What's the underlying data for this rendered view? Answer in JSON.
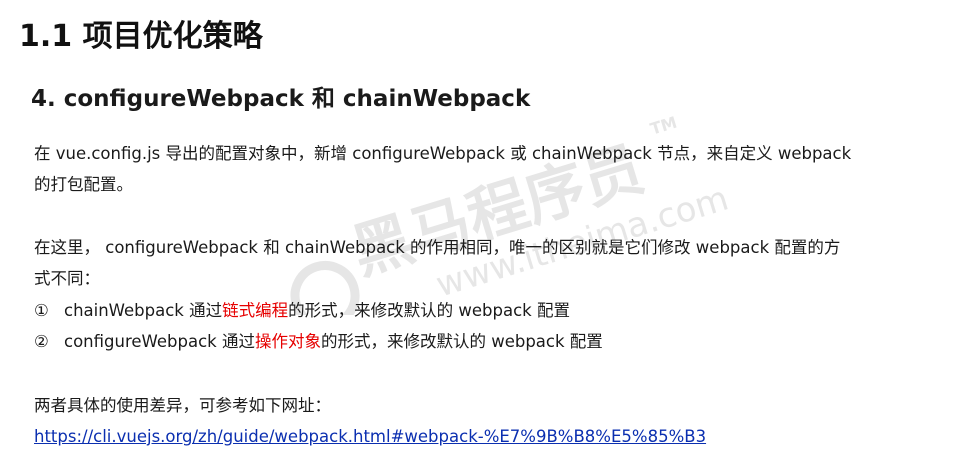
{
  "heading": "1.1 项目优化策略",
  "subheading": "4. configureWebpack 和 chainWebpack",
  "paragraph1": {
    "line1": "在 vue.config.js 导出的配置对象中，新增 configureWebpack 或 chainWebpack 节点，来自定义 webpack",
    "line2": "的打包配置。"
  },
  "paragraph2": {
    "line1": "在这里， configureWebpack 和 chainWebpack 的作用相同，唯一的区别就是它们修改 webpack 配置的方",
    "line2": "式不同："
  },
  "list": [
    {
      "marker": "①",
      "before": "chainWebpack 通过",
      "highlight": "链式编程",
      "after": "的形式，来修改默认的 webpack 配置"
    },
    {
      "marker": "②",
      "before": "configureWebpack 通过",
      "highlight": "操作对象",
      "after": "的形式，来修改默认的 webpack 配置"
    }
  ],
  "paragraph3": "两者具体的使用差异，可参考如下网址：",
  "link": "https://cli.vuejs.org/zh/guide/webpack.html#webpack-%E7%9B%B8%E5%85%B3",
  "watermark": {
    "brand": "黑马程序员",
    "site": "www.itheima.com",
    "tm": "TM"
  },
  "colors": {
    "highlight": "#e60000",
    "link": "#0b2fb0",
    "watermark": "#e3e3e3"
  }
}
